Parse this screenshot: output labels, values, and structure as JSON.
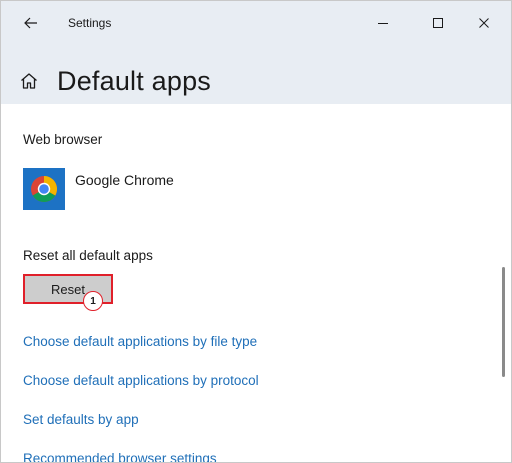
{
  "window": {
    "title": "Settings"
  },
  "page": {
    "title": "Default apps"
  },
  "web_browser": {
    "label": "Web browser",
    "app_name": "Google Chrome"
  },
  "reset": {
    "label": "Reset all default apps",
    "button_label": "Reset",
    "step_badge": "1"
  },
  "links": [
    "Choose default applications by file type",
    "Choose default applications by protocol",
    "Set defaults by app",
    "Recommended browser settings"
  ],
  "colors": {
    "header_band": "#e8edf3",
    "link": "#1f6fb8",
    "highlight": "#e0202a",
    "app_tile": "#1d72c4",
    "button": "#cdcdcd"
  },
  "icons": {
    "back": "arrow-left-icon",
    "minimize": "minimize-icon",
    "maximize": "maximize-icon",
    "close": "close-icon",
    "home": "home-icon",
    "chrome": "chrome-icon"
  }
}
